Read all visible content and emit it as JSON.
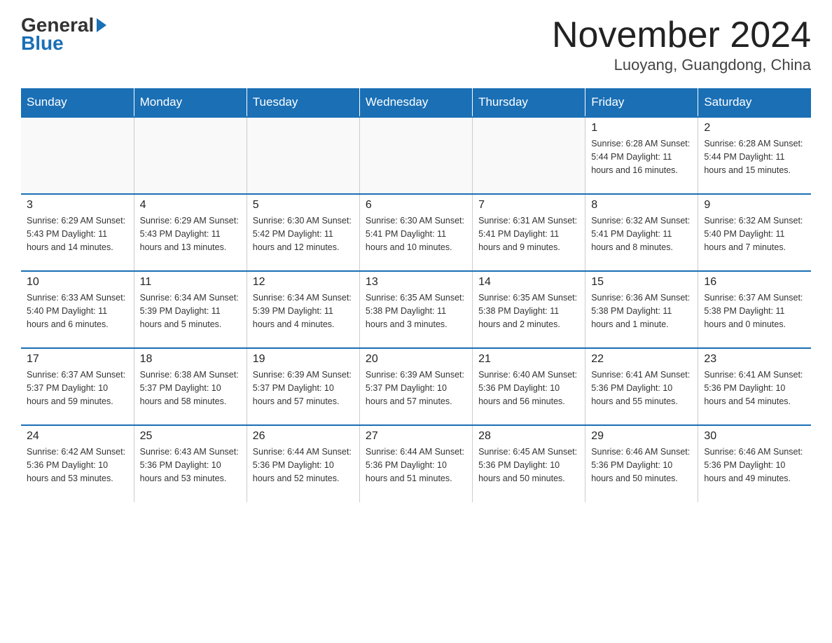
{
  "header": {
    "logo_general": "General",
    "logo_blue": "Blue",
    "title": "November 2024",
    "location": "Luoyang, Guangdong, China"
  },
  "calendar": {
    "weekdays": [
      "Sunday",
      "Monday",
      "Tuesday",
      "Wednesday",
      "Thursday",
      "Friday",
      "Saturday"
    ],
    "weeks": [
      [
        {
          "day": "",
          "info": ""
        },
        {
          "day": "",
          "info": ""
        },
        {
          "day": "",
          "info": ""
        },
        {
          "day": "",
          "info": ""
        },
        {
          "day": "",
          "info": ""
        },
        {
          "day": "1",
          "info": "Sunrise: 6:28 AM\nSunset: 5:44 PM\nDaylight: 11 hours and 16 minutes."
        },
        {
          "day": "2",
          "info": "Sunrise: 6:28 AM\nSunset: 5:44 PM\nDaylight: 11 hours and 15 minutes."
        }
      ],
      [
        {
          "day": "3",
          "info": "Sunrise: 6:29 AM\nSunset: 5:43 PM\nDaylight: 11 hours and 14 minutes."
        },
        {
          "day": "4",
          "info": "Sunrise: 6:29 AM\nSunset: 5:43 PM\nDaylight: 11 hours and 13 minutes."
        },
        {
          "day": "5",
          "info": "Sunrise: 6:30 AM\nSunset: 5:42 PM\nDaylight: 11 hours and 12 minutes."
        },
        {
          "day": "6",
          "info": "Sunrise: 6:30 AM\nSunset: 5:41 PM\nDaylight: 11 hours and 10 minutes."
        },
        {
          "day": "7",
          "info": "Sunrise: 6:31 AM\nSunset: 5:41 PM\nDaylight: 11 hours and 9 minutes."
        },
        {
          "day": "8",
          "info": "Sunrise: 6:32 AM\nSunset: 5:41 PM\nDaylight: 11 hours and 8 minutes."
        },
        {
          "day": "9",
          "info": "Sunrise: 6:32 AM\nSunset: 5:40 PM\nDaylight: 11 hours and 7 minutes."
        }
      ],
      [
        {
          "day": "10",
          "info": "Sunrise: 6:33 AM\nSunset: 5:40 PM\nDaylight: 11 hours and 6 minutes."
        },
        {
          "day": "11",
          "info": "Sunrise: 6:34 AM\nSunset: 5:39 PM\nDaylight: 11 hours and 5 minutes."
        },
        {
          "day": "12",
          "info": "Sunrise: 6:34 AM\nSunset: 5:39 PM\nDaylight: 11 hours and 4 minutes."
        },
        {
          "day": "13",
          "info": "Sunrise: 6:35 AM\nSunset: 5:38 PM\nDaylight: 11 hours and 3 minutes."
        },
        {
          "day": "14",
          "info": "Sunrise: 6:35 AM\nSunset: 5:38 PM\nDaylight: 11 hours and 2 minutes."
        },
        {
          "day": "15",
          "info": "Sunrise: 6:36 AM\nSunset: 5:38 PM\nDaylight: 11 hours and 1 minute."
        },
        {
          "day": "16",
          "info": "Sunrise: 6:37 AM\nSunset: 5:38 PM\nDaylight: 11 hours and 0 minutes."
        }
      ],
      [
        {
          "day": "17",
          "info": "Sunrise: 6:37 AM\nSunset: 5:37 PM\nDaylight: 10 hours and 59 minutes."
        },
        {
          "day": "18",
          "info": "Sunrise: 6:38 AM\nSunset: 5:37 PM\nDaylight: 10 hours and 58 minutes."
        },
        {
          "day": "19",
          "info": "Sunrise: 6:39 AM\nSunset: 5:37 PM\nDaylight: 10 hours and 57 minutes."
        },
        {
          "day": "20",
          "info": "Sunrise: 6:39 AM\nSunset: 5:37 PM\nDaylight: 10 hours and 57 minutes."
        },
        {
          "day": "21",
          "info": "Sunrise: 6:40 AM\nSunset: 5:36 PM\nDaylight: 10 hours and 56 minutes."
        },
        {
          "day": "22",
          "info": "Sunrise: 6:41 AM\nSunset: 5:36 PM\nDaylight: 10 hours and 55 minutes."
        },
        {
          "day": "23",
          "info": "Sunrise: 6:41 AM\nSunset: 5:36 PM\nDaylight: 10 hours and 54 minutes."
        }
      ],
      [
        {
          "day": "24",
          "info": "Sunrise: 6:42 AM\nSunset: 5:36 PM\nDaylight: 10 hours and 53 minutes."
        },
        {
          "day": "25",
          "info": "Sunrise: 6:43 AM\nSunset: 5:36 PM\nDaylight: 10 hours and 53 minutes."
        },
        {
          "day": "26",
          "info": "Sunrise: 6:44 AM\nSunset: 5:36 PM\nDaylight: 10 hours and 52 minutes."
        },
        {
          "day": "27",
          "info": "Sunrise: 6:44 AM\nSunset: 5:36 PM\nDaylight: 10 hours and 51 minutes."
        },
        {
          "day": "28",
          "info": "Sunrise: 6:45 AM\nSunset: 5:36 PM\nDaylight: 10 hours and 50 minutes."
        },
        {
          "day": "29",
          "info": "Sunrise: 6:46 AM\nSunset: 5:36 PM\nDaylight: 10 hours and 50 minutes."
        },
        {
          "day": "30",
          "info": "Sunrise: 6:46 AM\nSunset: 5:36 PM\nDaylight: 10 hours and 49 minutes."
        }
      ]
    ]
  }
}
